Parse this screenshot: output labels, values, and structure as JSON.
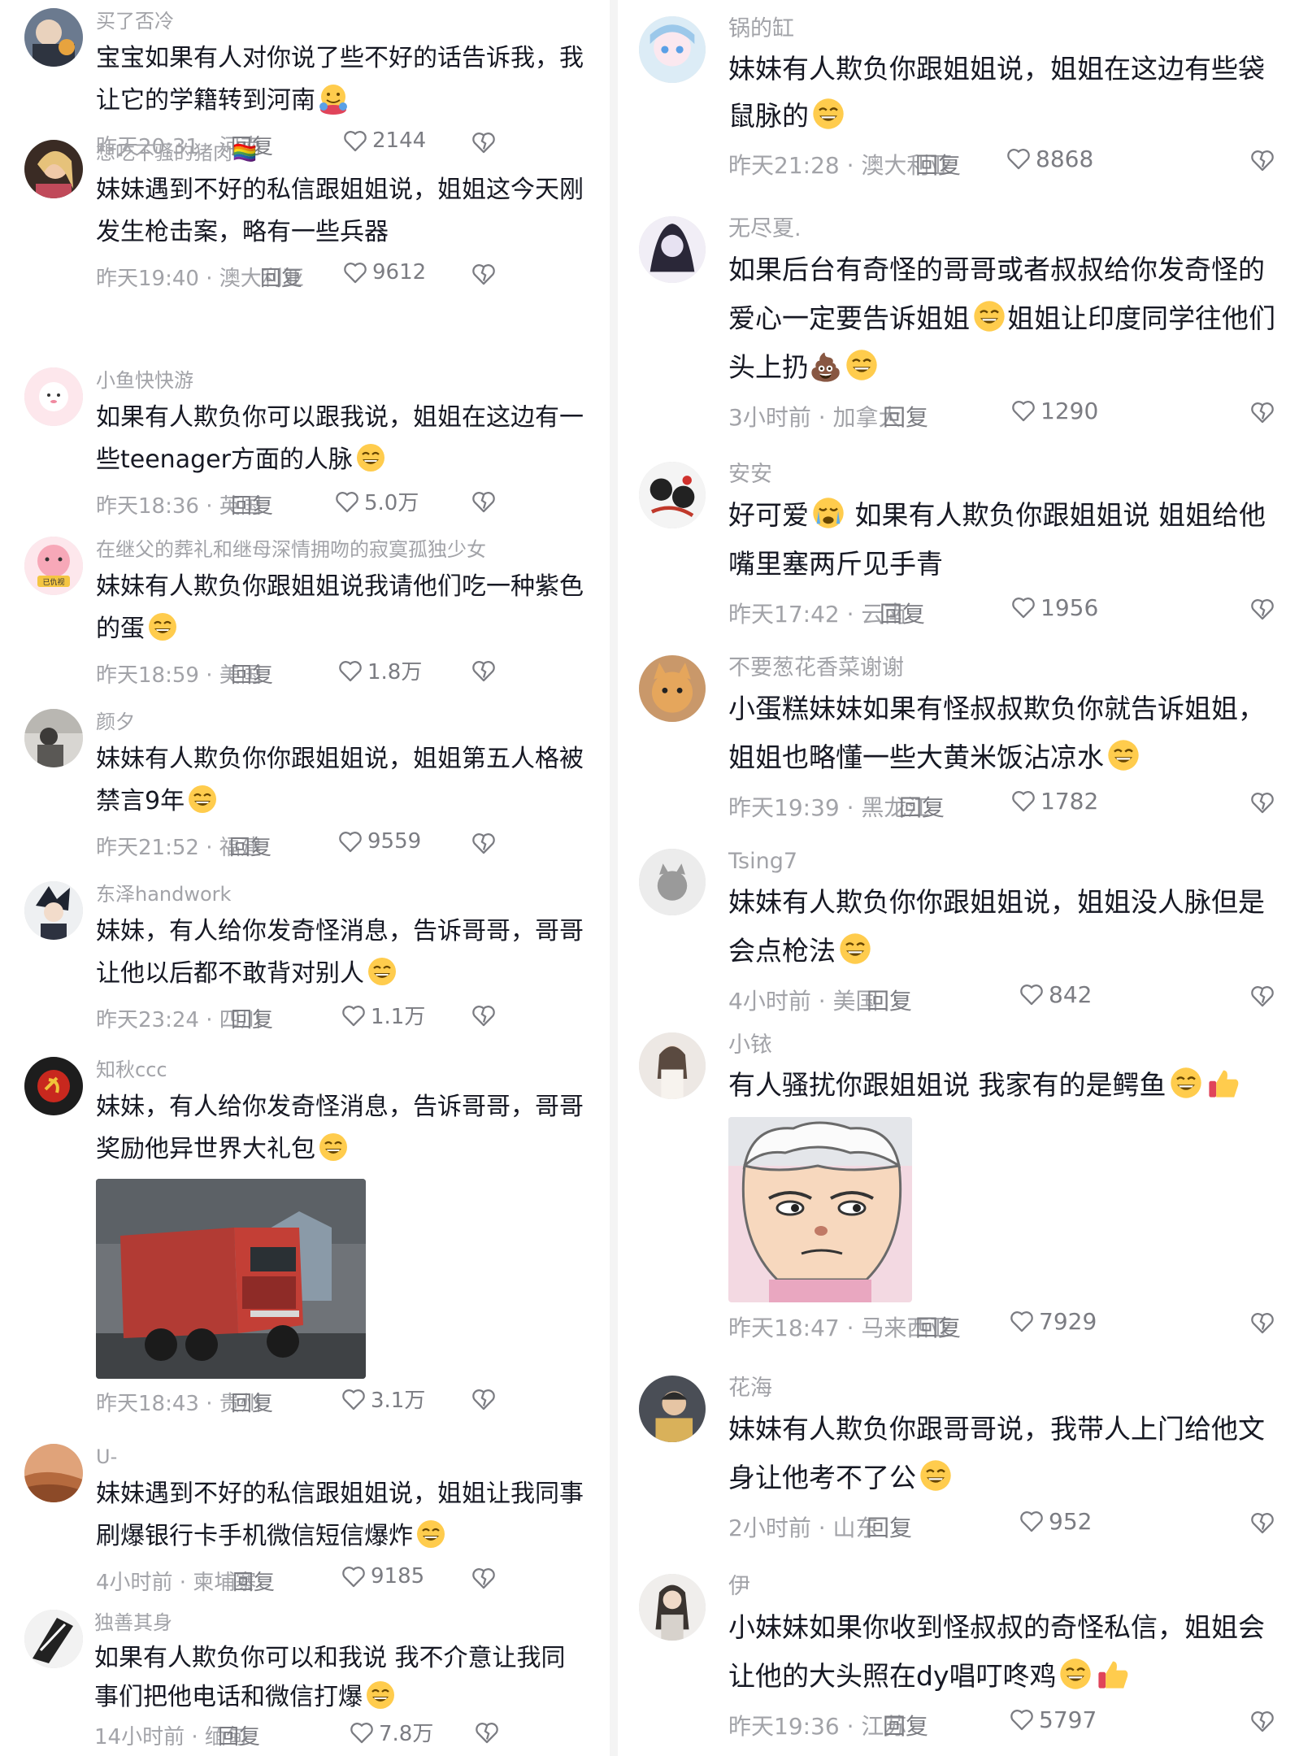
{
  "colors": {
    "text": "#161823",
    "muted": "#a2a3a8",
    "icon": "#7b7c82"
  },
  "reply_label": "回复",
  "left": [
    {
      "user": "买了否冷",
      "text": "宝宝如果有人对你说了些不好的话告诉我，我让它的学籍转到河南",
      "emoji": "hug-emoji",
      "time": "昨天20:31",
      "loc": "河南",
      "likes": "2144"
    },
    {
      "user": "想吃不骚的猪肉🏳️‍🌈",
      "text": "妹妹遇到不好的私信跟姐姐说，姐姐这今天刚发生枪击案，略有一些兵器",
      "emoji": "",
      "time": "昨天19:40",
      "loc": "澳大利亚",
      "likes": "9612"
    },
    {
      "user": "小鱼快快游",
      "text": "如果有人欺负你可以跟我说，姐姐在这边有一些teenager方面的人脉",
      "emoji": "smile-emoji",
      "time": "昨天18:36",
      "loc": "英国",
      "likes": "5.0万"
    },
    {
      "user": "在继父的葬礼和继母深情拥吻的寂寞孤独少女",
      "text": "妹妹有人欺负你跟姐姐说我请他们吃一种紫色的蛋",
      "emoji": "smile-emoji",
      "time": "昨天18:59",
      "loc": "美国",
      "likes": "1.8万"
    },
    {
      "user": "颜夕",
      "text": "妹妹有人欺负你你跟姐姐说，姐姐第五人格被禁言9年",
      "emoji": "smile-emoji",
      "time": "昨天21:52",
      "loc": "福建",
      "likes": "9559"
    },
    {
      "user": "东泽handwork",
      "text": "妹妹，有人给你发奇怪消息，告诉哥哥，哥哥让他以后都不敢背对别人",
      "emoji": "smile-emoji",
      "time": "昨天23:24",
      "loc": "四川",
      "likes": "1.1万"
    },
    {
      "user": "知秋ccc",
      "text": "妹妹，有人给你发奇怪消息，告诉哥哥，哥哥奖励他异世界大礼包",
      "emoji": "smile-emoji",
      "time": "昨天18:43",
      "loc": "贵州",
      "likes": "3.1万",
      "photo": "red-truck-photo"
    },
    {
      "user": "U-",
      "text": "妹妹遇到不好的私信跟姐姐说，姐姐让我同事刷爆银行卡手机微信短信爆炸",
      "emoji": "smile-emoji",
      "time": "4小时前",
      "loc": "柬埔寨",
      "likes": "9185"
    },
    {
      "user": "独善其身",
      "text": "如果有人欺负你可以和我说 我不介意让我同事们把他电话和微信打爆",
      "emoji": "smile-emoji",
      "time": "14小时前",
      "loc": "缅甸",
      "likes": "7.8万"
    }
  ],
  "right": [
    {
      "user": "锅的缸",
      "text": "妹妹有人欺负你跟姐姐说，姐姐在这边有些袋鼠脉的",
      "emoji": "smile-emoji",
      "time": "昨天21:28",
      "loc": "澳大利亚",
      "likes": "8868"
    },
    {
      "user": "无尽夏.",
      "text": "如果后台有奇怪的哥哥或者叔叔给你发奇怪的爱心一定要告诉姐姐",
      "emoji": "smile-emoji",
      "text2": "姐姐让印度同学往他们头上扔💩",
      "emoji2": "smile-emoji",
      "time": "3小时前",
      "loc": "加拿大",
      "likes": "1290"
    },
    {
      "user": "安安",
      "text": "好可爱",
      "emoji": "cry-emoji",
      "text2": " 如果有人欺负你跟姐姐说 姐姐给他嘴里塞两斤见手青",
      "time": "昨天17:42",
      "loc": "云南",
      "likes": "1956"
    },
    {
      "user": "不要葱花香菜谢谢",
      "text": "小蛋糕妹妹如果有怪叔叔欺负你就告诉姐姐，姐姐也略懂一些大黄米饭沾凉水",
      "emoji": "smile-emoji",
      "time": "昨天19:39",
      "loc": "黑龙江",
      "likes": "1782"
    },
    {
      "user": "Tsing7",
      "text": "妹妹有人欺负你你跟姐姐说，姐姐没人脉但是会点枪法",
      "emoji": "smile-emoji",
      "time": "4小时前",
      "loc": "美国",
      "likes": "842"
    },
    {
      "user": "小铱",
      "text": "有人骚扰你跟姐姐说 我家有的是鳄鱼",
      "emoji": "smile-emoji",
      "emoji3": "thumbs-up-emoji",
      "time": "昨天18:47",
      "loc": "马来西亚",
      "likes": "7929",
      "photo": "cartoon-sticker"
    },
    {
      "user": "花海",
      "text": "妹妹有人欺负你跟哥哥说，我带人上门给他文身让他考不了公",
      "emoji": "smile-emoji",
      "time": "2小时前",
      "loc": "山东",
      "likes": "952"
    },
    {
      "user": "伊",
      "text": "小妹妹如果你收到怪叔叔的奇怪私信，姐姐会让他的大头照在dy唱叮咚鸡",
      "emoji": "smile-emoji",
      "emoji3": "thumbs-up-emoji",
      "time": "昨天19:36",
      "loc": "江苏",
      "likes": "5797"
    }
  ]
}
